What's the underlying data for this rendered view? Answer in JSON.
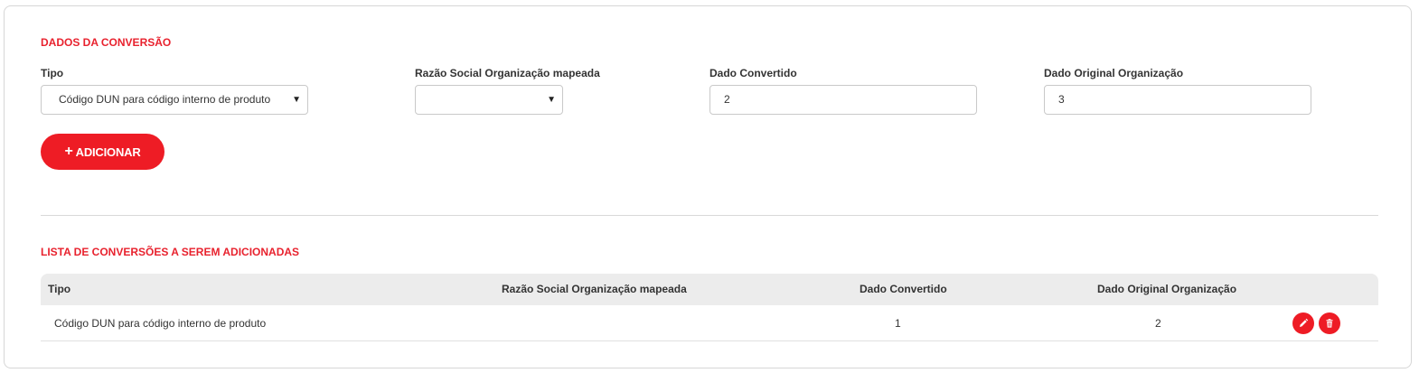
{
  "form": {
    "section_title": "DADOS DA CONVERSÃO",
    "tipo": {
      "label": "Tipo",
      "value": "Código DUN para código interno de produto"
    },
    "razao_social": {
      "label": "Razão Social Organização mapeada",
      "value": ""
    },
    "dado_convertido": {
      "label": "Dado Convertido",
      "value": "2"
    },
    "dado_original": {
      "label": "Dado Original Organização",
      "value": "3"
    },
    "add_button_icon": "+",
    "add_button_label": "ADICIONAR"
  },
  "list": {
    "section_title": "LISTA DE CONVERSÕES A SEREM ADICIONADAS",
    "columns": [
      "Tipo",
      "Razão Social Organização mapeada",
      "Dado Convertido",
      "Dado Original Organização"
    ],
    "rows": [
      {
        "tipo": "Código DUN para código interno de produto",
        "razao_social": "",
        "dado_convertido": "1",
        "dado_original": "2",
        "actions": [
          "pencil-icon",
          "trash-icon"
        ]
      }
    ]
  },
  "colors": {
    "accent": "#ee1c25",
    "title": "#e8222e",
    "header_bg": "#ececec"
  }
}
